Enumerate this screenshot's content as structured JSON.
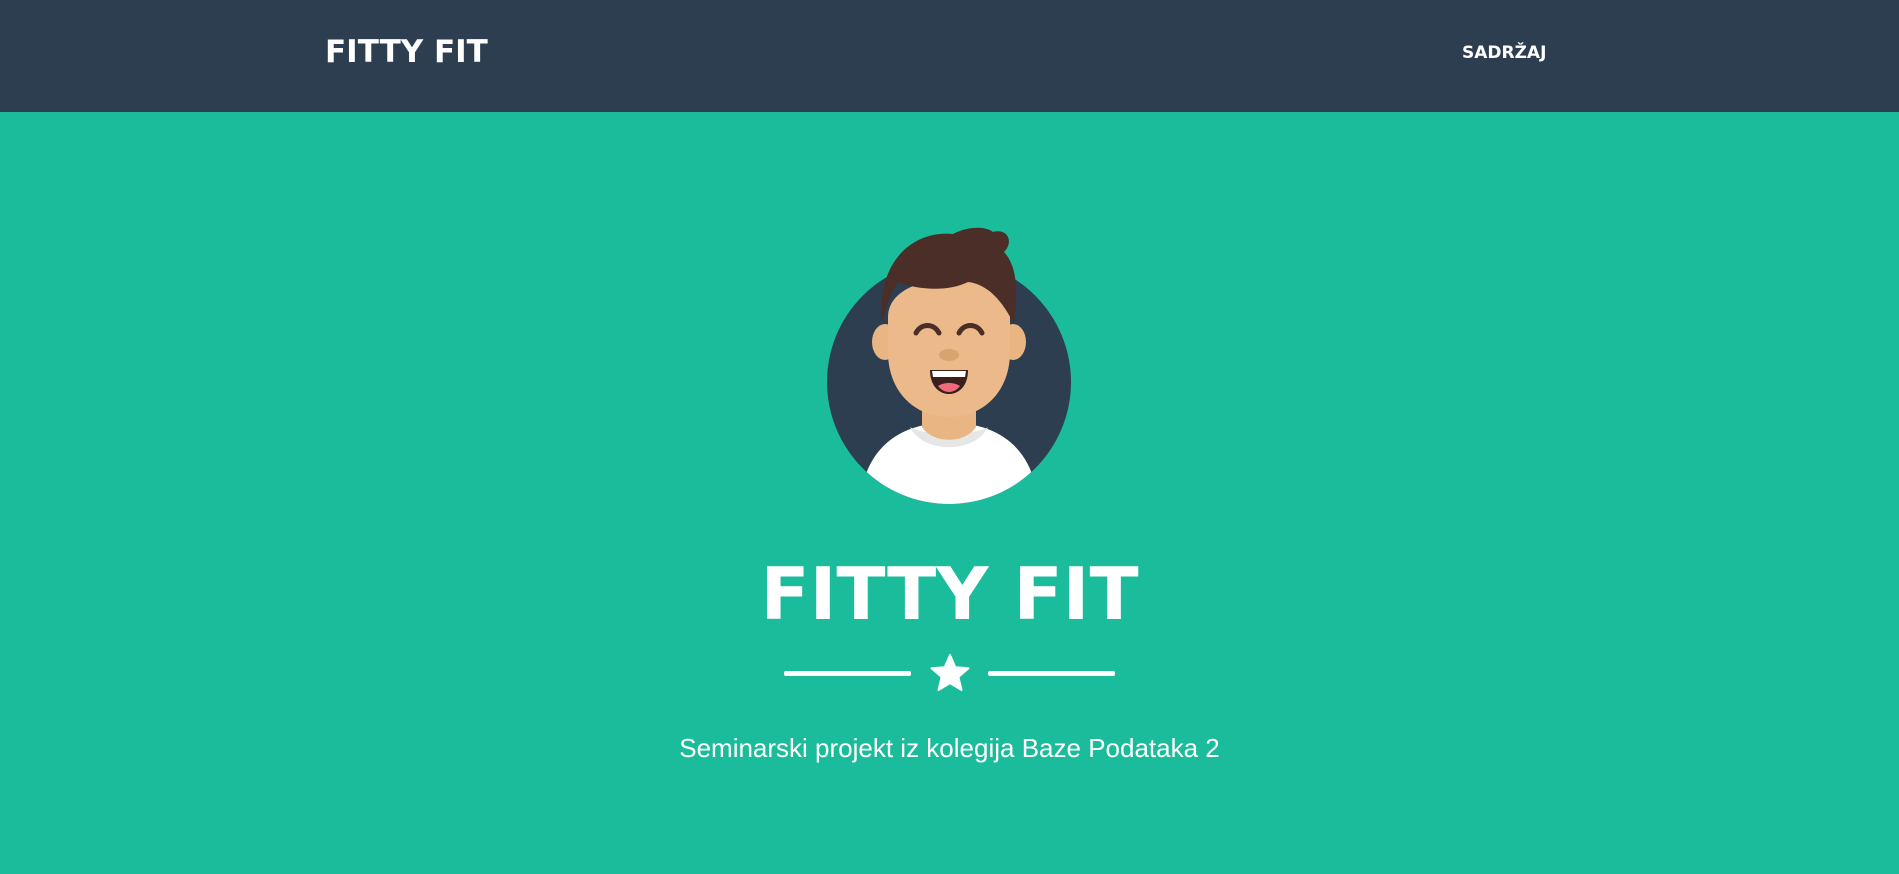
{
  "navbar": {
    "brand": "FITTY FIT",
    "links": [
      {
        "label": "SADRŽAJ"
      }
    ]
  },
  "masthead": {
    "avatar_icon": "smiling-person-avatar-icon",
    "title": "FITTY FIT",
    "divider_icon": "star-icon",
    "subtitle": "Seminarski projekt iz kolegija Baze Podataka 2"
  },
  "colors": {
    "navbar_bg": "#2c3e50",
    "masthead_bg": "#1abc9c",
    "text": "#ffffff"
  }
}
